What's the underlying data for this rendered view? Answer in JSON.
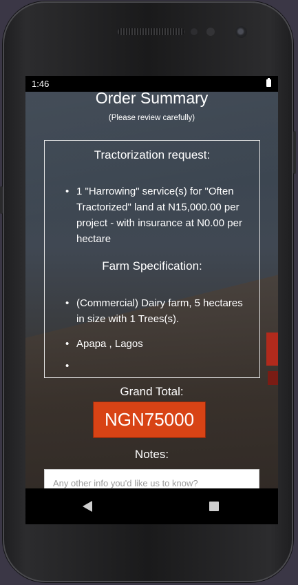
{
  "status_bar": {
    "time": "1:46",
    "battery_icon": "battery-icon"
  },
  "header": {
    "title": "Order Summary",
    "subtitle": "(Please review carefully)"
  },
  "tractorization": {
    "heading": "Tractorization request:",
    "items": [
      "1 \"Harrowing\" service(s) for \"Often Tractorized\" land at N15,000.00 per project - with insurance at N0.00 per hectare"
    ]
  },
  "farm": {
    "heading": "Farm Specification:",
    "items": [
      "(Commercial) Dairy farm, 5 hectares in size with 1 Trees(s).",
      "Apapa , Lagos",
      ""
    ]
  },
  "total": {
    "label": "Grand Total:",
    "value": "NGN75000",
    "color": "#d84315"
  },
  "notes": {
    "label": "Notes:",
    "placeholder": "Any other info you'd like us to know?",
    "value": ""
  },
  "nav": {
    "back_icon": "back-triangle-icon",
    "recent_icon": "recent-apps-square-icon"
  }
}
